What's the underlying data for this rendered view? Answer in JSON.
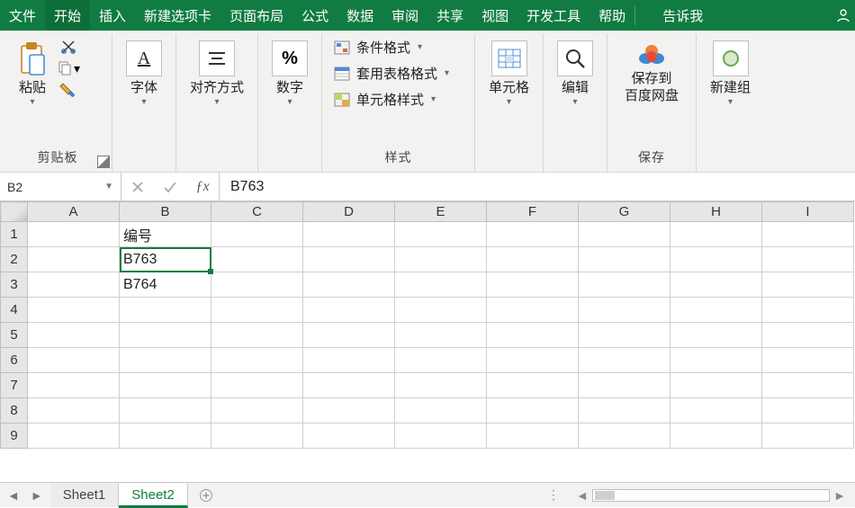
{
  "colors": {
    "brand": "#107c41"
  },
  "menu": {
    "tabs": [
      "文件",
      "开始",
      "插入",
      "新建选项卡",
      "页面布局",
      "公式",
      "数据",
      "审阅",
      "共享",
      "视图",
      "开发工具",
      "帮助"
    ],
    "active_index": 1,
    "tell_me": "告诉我"
  },
  "ribbon": {
    "clipboard": {
      "paste": "粘贴",
      "group": "剪贴板"
    },
    "font": {
      "label": "字体"
    },
    "align": {
      "label": "对齐方式"
    },
    "number": {
      "label": "数字"
    },
    "styles": {
      "cond": "条件格式",
      "table": "套用表格格式",
      "cellstyle": "单元格样式",
      "group": "样式"
    },
    "cells": {
      "label": "单元格"
    },
    "edit": {
      "label": "编辑"
    },
    "save": {
      "btn": "保存到\n百度网盘",
      "group": "保存"
    },
    "newgroup": {
      "label": "新建组"
    }
  },
  "fbar": {
    "namebox": "B2",
    "formula": "B763"
  },
  "grid": {
    "cols": [
      "A",
      "B",
      "C",
      "D",
      "E",
      "F",
      "G",
      "H",
      "I"
    ],
    "rows": [
      1,
      2,
      3,
      4,
      5,
      6,
      7,
      8,
      9
    ],
    "cells": {
      "B1": "编号",
      "B2": "B763",
      "B3": "B764"
    },
    "selected": "B2"
  },
  "sheets": {
    "tabs": [
      "Sheet1",
      "Sheet2"
    ],
    "active_index": 1
  }
}
